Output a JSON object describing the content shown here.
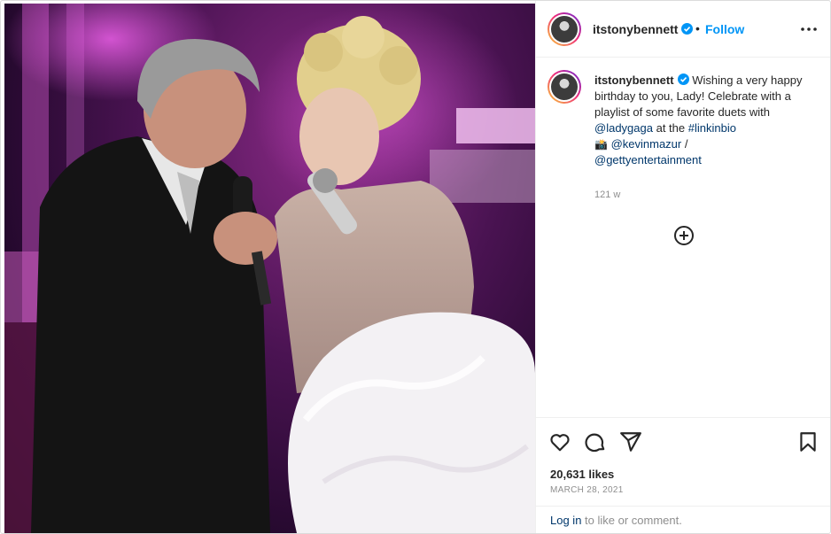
{
  "header": {
    "username": "itstonybennett",
    "separator": "•",
    "follow_label": "Follow",
    "more_icon": "more-dots-icon"
  },
  "caption": {
    "username": "itstonybennett",
    "text_1": "Wishing a very happy birthday to you, Lady! Celebrate with a playlist of some favorite duets with",
    "mention_1": "@ladygaga",
    "text_2": "at the",
    "hashtag": "#linkinbio",
    "camera_emoji": "📸",
    "mention_2": "@kevinmazur",
    "slash": "/",
    "mention_3": "@gettyentertainment",
    "time_ago": "121 w"
  },
  "add_comment_icon": "plus-circle-icon",
  "actions": {
    "like_icon": "heart-icon",
    "comment_icon": "comment-bubble-icon",
    "share_icon": "paper-plane-icon",
    "save_icon": "bookmark-icon"
  },
  "likes": "20,631 likes",
  "date": "MARCH 28, 2021",
  "login": {
    "link_label": "Log in",
    "rest_label": "to like or comment."
  },
  "colors": {
    "accent": "#0095f6",
    "link": "#00376b",
    "muted": "#8e8e8e",
    "verified": "#0095f6"
  }
}
